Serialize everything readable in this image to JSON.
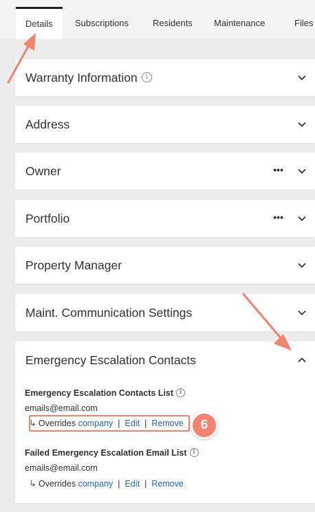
{
  "tabs": [
    {
      "label": "Details"
    },
    {
      "label": "Subscriptions"
    },
    {
      "label": "Residents"
    },
    {
      "label": "Maintenance"
    },
    {
      "label": "Files"
    }
  ],
  "panels": {
    "warranty": {
      "title": "Warranty Information"
    },
    "address": {
      "title": "Address"
    },
    "owner": {
      "title": "Owner",
      "more": "•••"
    },
    "portfolio": {
      "title": "Portfolio",
      "more": "•••"
    },
    "property_manager": {
      "title": "Property Manager"
    },
    "maint_comm": {
      "title": "Maint. Communication Settings"
    },
    "emergency": {
      "title": "Emergency Escalation Contacts",
      "contacts_list": {
        "label": "Emergency Escalation Contacts List",
        "email": "emails@email.com",
        "overrides_prefix": "Overrides",
        "company_link": "company",
        "edit_link": "Edit",
        "remove_link": "Remove"
      },
      "failed_list": {
        "label": "Failed Emergency Escalation Email List",
        "email": "emails@email.com",
        "overrides_prefix": "Overrides",
        "company_link": "company",
        "edit_link": "Edit",
        "remove_link": "Remove"
      }
    }
  },
  "annotation": {
    "step_number": "6",
    "color": "#f3826e"
  },
  "colors": {
    "link": "#2266c9",
    "text": "#323130",
    "background": "#ececec",
    "panel": "#ffffff"
  },
  "icons": {
    "info": "info-icon",
    "chevron_down": "chevron-down-icon",
    "chevron_up": "chevron-up-icon",
    "more": "more-icon",
    "arrow": "return-arrow-icon"
  }
}
